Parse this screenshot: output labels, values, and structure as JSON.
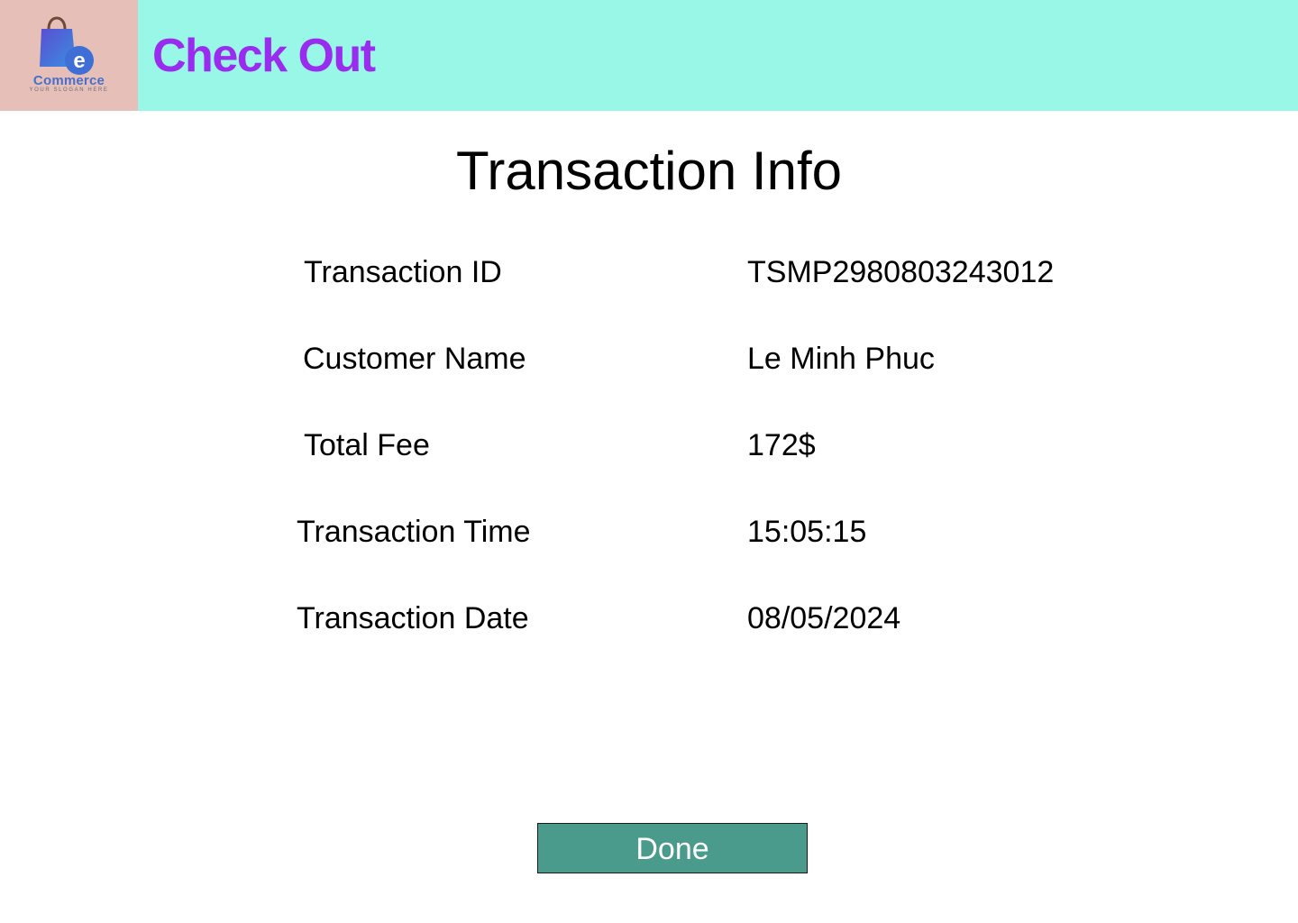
{
  "header": {
    "logo": {
      "icon": "shopping-bag-icon",
      "name": "Commerce",
      "slogan": "YOUR SLOGAN HERE",
      "letter": "e"
    },
    "title": "Check Out",
    "colors": {
      "background": "#98f7e6",
      "logo_background": "#e6c0b8",
      "title": "#9a2cf0"
    }
  },
  "main": {
    "title": "Transaction Info",
    "rows": [
      {
        "label": "Transaction ID",
        "value": "TSMP2980803243012"
      },
      {
        "label": "Customer Name",
        "value": "Le Minh Phuc"
      },
      {
        "label": "Total Fee",
        "value": "172$"
      },
      {
        "label": "Transaction Time",
        "value": "15:05:15"
      },
      {
        "label": "Transaction Date",
        "value": "08/05/2024"
      }
    ]
  },
  "actions": {
    "done_label": "Done",
    "done_color": "#4a9b8b"
  }
}
